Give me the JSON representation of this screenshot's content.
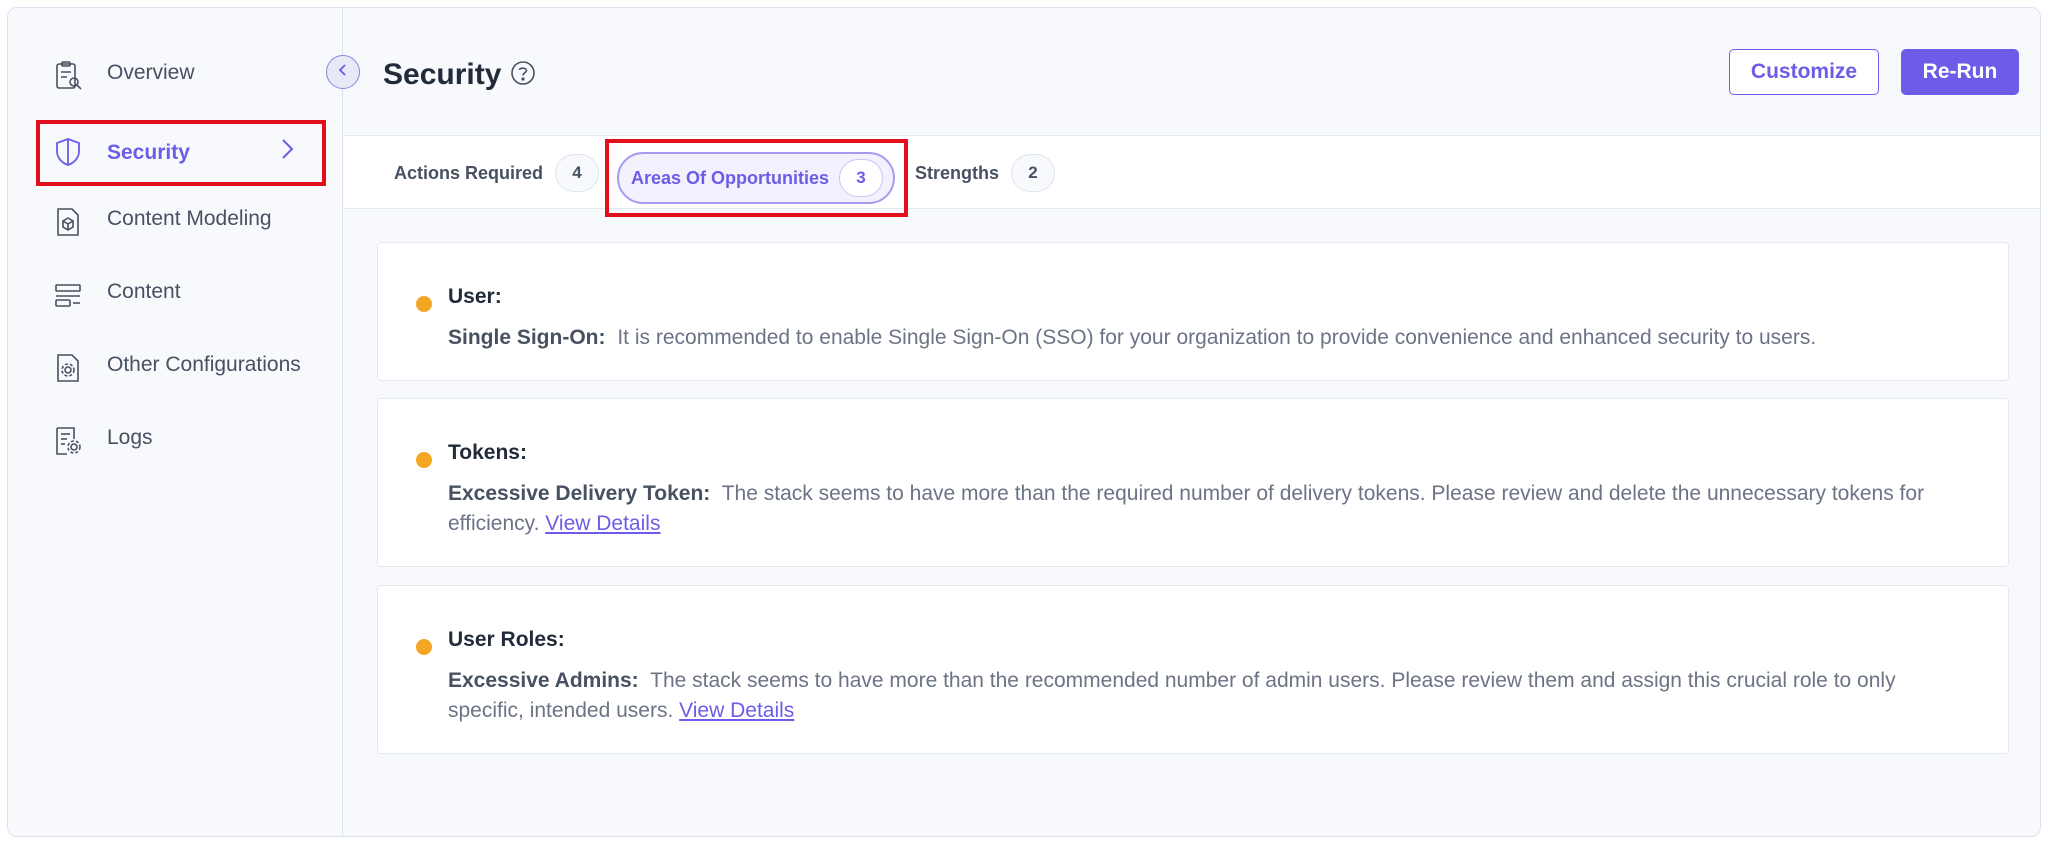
{
  "sidebar": {
    "items": [
      {
        "label": "Overview",
        "icon": "clipboard-search-icon"
      },
      {
        "label": "Security",
        "icon": "shield-icon",
        "active": true
      },
      {
        "label": "Content Modeling",
        "icon": "document-cube-icon"
      },
      {
        "label": "Content",
        "icon": "content-list-icon"
      },
      {
        "label": "Other Configurations",
        "icon": "document-gear-icon"
      },
      {
        "label": "Logs",
        "icon": "log-gear-icon"
      }
    ]
  },
  "header": {
    "title": "Security",
    "customize_label": "Customize",
    "rerun_label": "Re-Run"
  },
  "tabs": [
    {
      "label": "Actions Required",
      "count": "4"
    },
    {
      "label": "Areas Of Opportunities",
      "count": "3",
      "active": true
    },
    {
      "label": "Strengths",
      "count": "2"
    }
  ],
  "cards": [
    {
      "title": "User:",
      "key": "Single Sign-On:",
      "text": "It is recommended to enable Single Sign-On (SSO) for your organization to provide convenience and enhanced security to users."
    },
    {
      "title": "Tokens:",
      "key": "Excessive Delivery Token:",
      "text": "The stack seems to have more than the required number of delivery tokens. Please review and delete the unnecessary tokens for efficiency.",
      "link": "View Details"
    },
    {
      "title": "User Roles:",
      "key": "Excessive Admins:",
      "text": "The stack seems to have more than the recommended number of admin users. Please review them and assign this crucial role to only specific, intended users.",
      "link": "View Details"
    }
  ],
  "colors": {
    "accent": "#6c5ce7",
    "highlight": "#e0111b",
    "warning_dot": "#f5a623"
  }
}
